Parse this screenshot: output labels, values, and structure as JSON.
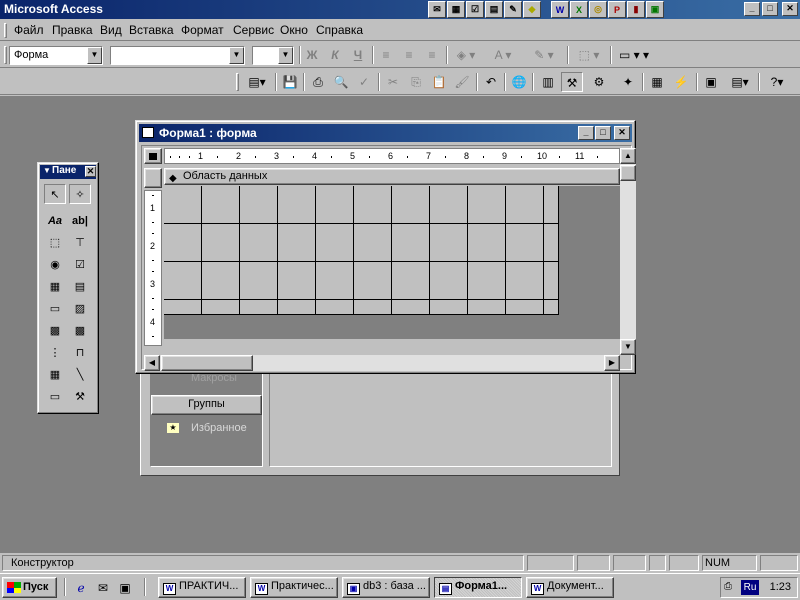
{
  "app": {
    "title": "Microsoft Access",
    "window_buttons": [
      "_",
      "□",
      "✕"
    ]
  },
  "office_bar": {
    "items": [
      "mail-icon",
      "calendar-icon",
      "task-icon",
      "contact-icon",
      "journal-icon",
      "note-icon",
      "word-icon",
      "excel-icon",
      "outlook-icon",
      "powerpoint-icon",
      "access-icon",
      "binder-icon"
    ]
  },
  "menu": {
    "items": [
      "Файл",
      "Правка",
      "Вид",
      "Вставка",
      "Формат",
      "Сервис",
      "Окно",
      "Справка"
    ]
  },
  "format_toolbar": {
    "object_value": "Форма",
    "font_value": "",
    "size_value": "",
    "bold": "Ж",
    "italic": "К",
    "underline": "Ч"
  },
  "toolbox": {
    "title": "Пане",
    "tools": [
      "select-objects-icon",
      "control-wizards-icon",
      "label-icon",
      "textbox-icon",
      "option-group-icon",
      "toggle-button-icon",
      "option-button-icon",
      "checkbox-icon",
      "combo-box-icon",
      "list-box-icon",
      "command-button-icon",
      "image-icon",
      "unbound-object-icon",
      "bound-object-icon",
      "page-break-icon",
      "tab-control-icon",
      "subform-icon",
      "line-icon",
      "rectangle-icon",
      "more-controls-icon"
    ],
    "label_glyph": "Aa",
    "textbox_glyph": "ab|"
  },
  "form_window": {
    "title": "Форма1 : форма",
    "section_label": "Область данных",
    "ruler_h": [
      "1",
      "2",
      "3",
      "4",
      "5",
      "6",
      "7",
      "8",
      "9",
      "10",
      "11"
    ],
    "ruler_v": [
      "1",
      "2",
      "3",
      "4"
    ]
  },
  "database_window": {
    "macros_label": "Макросы",
    "groups_button": "Группы",
    "favorites_label": "Избранное"
  },
  "statusbar": {
    "text": "Конструктор",
    "num": "NUM"
  },
  "taskbar": {
    "start_label": "Пуск",
    "tasks": [
      {
        "label": "ПРАКТИЧ...",
        "icon": "W"
      },
      {
        "label": "Практичес...",
        "icon": "W"
      },
      {
        "label": "db3 : база ...",
        "icon": "▣"
      },
      {
        "label": "Форма1...",
        "icon": "▤"
      },
      {
        "label": "Документ...",
        "icon": "W"
      }
    ],
    "lang": "Ru",
    "clock": "1:23"
  }
}
